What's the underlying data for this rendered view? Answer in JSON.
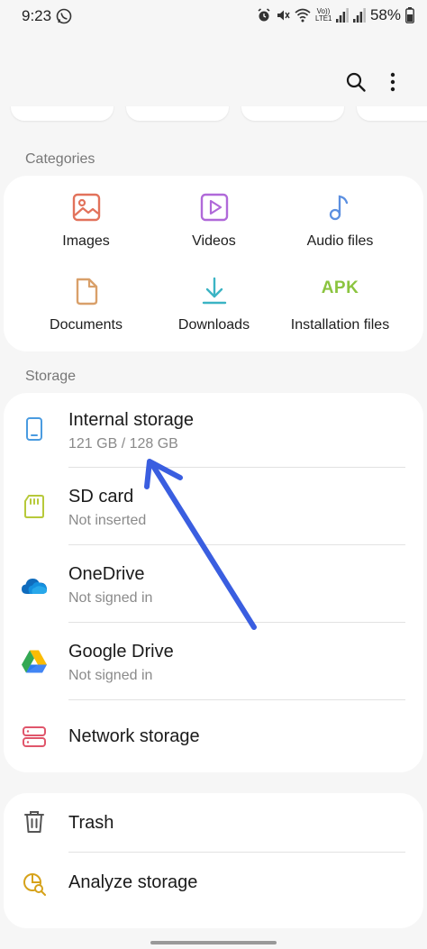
{
  "status_bar": {
    "time": "9:23",
    "battery": "58%",
    "network_label": "Vo)) LTE1"
  },
  "toolbar": {
    "search_icon": "search-icon",
    "more_icon": "more-vert-icon"
  },
  "categories": {
    "label": "Categories",
    "items": [
      {
        "label": "Images",
        "icon": "image-icon",
        "color": "#e2725b"
      },
      {
        "label": "Videos",
        "icon": "video-icon",
        "color": "#b069d9"
      },
      {
        "label": "Audio files",
        "icon": "music-note-icon",
        "color": "#5b8fe0"
      },
      {
        "label": "Documents",
        "icon": "document-icon",
        "color": "#d9a06a"
      },
      {
        "label": "Downloads",
        "icon": "download-icon",
        "color": "#3bb4c4"
      },
      {
        "label": "Installation files",
        "icon": "apk-icon",
        "icon_text": "APK",
        "color": "#8bc43f"
      }
    ]
  },
  "storage": {
    "label": "Storage",
    "items": [
      {
        "title": "Internal storage",
        "subtitle": "121 GB / 128 GB",
        "icon": "phone-icon",
        "color": "#4a9be0"
      },
      {
        "title": "SD card",
        "subtitle": "Not inserted",
        "icon": "sd-card-icon",
        "color": "#b7c93a"
      },
      {
        "title": "OneDrive",
        "subtitle": "Not signed in",
        "icon": "onedrive-icon",
        "color": "#0f6cbd"
      },
      {
        "title": "Google Drive",
        "subtitle": "Not signed in",
        "icon": "google-drive-icon",
        "color": "#34a853"
      },
      {
        "title": "Network storage",
        "subtitle": "",
        "icon": "network-storage-icon",
        "color": "#e0566b"
      }
    ]
  },
  "utilities": {
    "items": [
      {
        "title": "Trash",
        "icon": "trash-icon",
        "color": "#555555"
      },
      {
        "title": "Analyze storage",
        "icon": "analyze-storage-icon",
        "color": "#d6a21a"
      }
    ]
  },
  "annotation": {
    "arrow_color": "#3a5ee0",
    "arrow_icon": "arrow-annotation-icon"
  }
}
